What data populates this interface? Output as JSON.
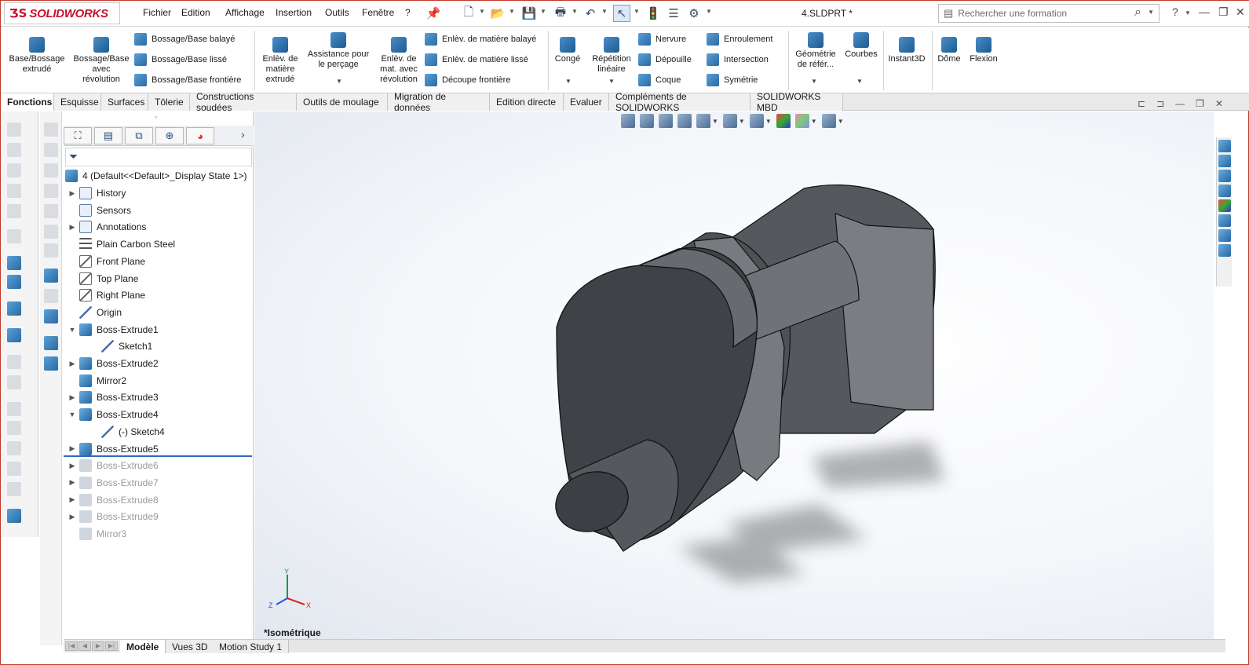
{
  "app": {
    "logo_text": "SOLIDWORKS",
    "document_title": "4.SLDPRT *"
  },
  "menu": [
    "Fichier",
    "Edition",
    "Affichage",
    "Insertion",
    "Outils",
    "Fenêtre",
    "?"
  ],
  "search": {
    "placeholder": "Rechercher une formation"
  },
  "ribbon": {
    "big_buttons": [
      {
        "label": "Base/Bossage\nextrudé"
      },
      {
        "label": "Bossage/Base\navec\nrévolution"
      },
      {
        "label": "Enlèv. de\nmatière\nextrudé"
      },
      {
        "label": "Assistance pour\nle perçage"
      },
      {
        "label": "Enlèv. de\nmat. avec\nrévolution"
      },
      {
        "label": "Congé"
      },
      {
        "label": "Répétition\nlinéaire"
      },
      {
        "label": "Géométrie\nde référ..."
      },
      {
        "label": "Courbes"
      },
      {
        "label": "Instant3D"
      },
      {
        "label": "Dôme"
      },
      {
        "label": "Flexion"
      }
    ],
    "small_buttons": {
      "col1": [
        "Bossage/Base balayé",
        "Bossage/Base lissé",
        "Bossage/Base frontière"
      ],
      "col2": [
        "Enlèv. de matière balayé",
        "Enlèv. de matière lissé",
        "Découpe frontière"
      ],
      "col3": [
        "Nervure",
        "Dépouille",
        "Coque"
      ],
      "col4": [
        "Enroulement",
        "Intersection",
        "Symétrie"
      ]
    }
  },
  "command_tabs": [
    "Fonctions",
    "Esquisse",
    "Surfaces",
    "Tôlerie",
    "Constructions soudées",
    "Outils de moulage",
    "Migration de données",
    "Edition directe",
    "Evaluer",
    "Compléments de SOLIDWORKS",
    "SOLIDWORKS MBD"
  ],
  "feature_tree": {
    "root": "4  (Default<<Default>_Display State 1>)",
    "items": [
      {
        "label": "History",
        "icon": "history-icon",
        "expand": "▶",
        "dim": false
      },
      {
        "label": "Sensors",
        "icon": "sensor-icon",
        "expand": "",
        "dim": false
      },
      {
        "label": "Annotations",
        "icon": "annotation-icon",
        "expand": "▶",
        "dim": false
      },
      {
        "label": "Plain Carbon Steel",
        "icon": "material-icon",
        "expand": "",
        "dim": false
      },
      {
        "label": "Front Plane",
        "icon": "plane-icon",
        "expand": "",
        "dim": false
      },
      {
        "label": "Top Plane",
        "icon": "plane-icon",
        "expand": "",
        "dim": false
      },
      {
        "label": "Right Plane",
        "icon": "plane-icon",
        "expand": "",
        "dim": false
      },
      {
        "label": "Origin",
        "icon": "origin-icon",
        "expand": "",
        "dim": false
      },
      {
        "label": "Boss-Extrude1",
        "icon": "extrude-icon",
        "expand": "▼",
        "dim": false
      },
      {
        "label": "Sketch1",
        "icon": "sketch-icon",
        "expand": "",
        "dim": false,
        "child": true
      },
      {
        "label": "Boss-Extrude2",
        "icon": "extrude-icon",
        "expand": "▶",
        "dim": false
      },
      {
        "label": "Mirror2",
        "icon": "mirror-icon",
        "expand": "",
        "dim": false
      },
      {
        "label": "Boss-Extrude3",
        "icon": "extrude-icon",
        "expand": "▶",
        "dim": false
      },
      {
        "label": "Boss-Extrude4",
        "icon": "extrude-icon",
        "expand": "▼",
        "dim": false
      },
      {
        "label": "(-) Sketch4",
        "icon": "sketch-icon",
        "expand": "",
        "dim": false,
        "child": true
      },
      {
        "label": "Boss-Extrude5",
        "icon": "extrude-icon",
        "expand": "▶",
        "dim": false
      },
      {
        "label": "Boss-Extrude6",
        "icon": "extrude-icon",
        "expand": "▶",
        "dim": true
      },
      {
        "label": "Boss-Extrude7",
        "icon": "extrude-icon",
        "expand": "▶",
        "dim": true
      },
      {
        "label": "Boss-Extrude8",
        "icon": "extrude-icon",
        "expand": "▶",
        "dim": true
      },
      {
        "label": "Boss-Extrude9",
        "icon": "extrude-icon",
        "expand": "▶",
        "dim": true
      },
      {
        "label": "Mirror3",
        "icon": "mirror-icon",
        "expand": "",
        "dim": true
      }
    ]
  },
  "viewport": {
    "view_label": "*Isométrique",
    "triad": {
      "x": "X",
      "y": "Y",
      "z": "Z"
    }
  },
  "bottom_tabs": [
    "Modèle",
    "Vues 3D",
    "Motion Study 1"
  ],
  "colors": {
    "brand": "#c8102e",
    "part": "#5b5f63",
    "rollback": "#3268c2"
  }
}
